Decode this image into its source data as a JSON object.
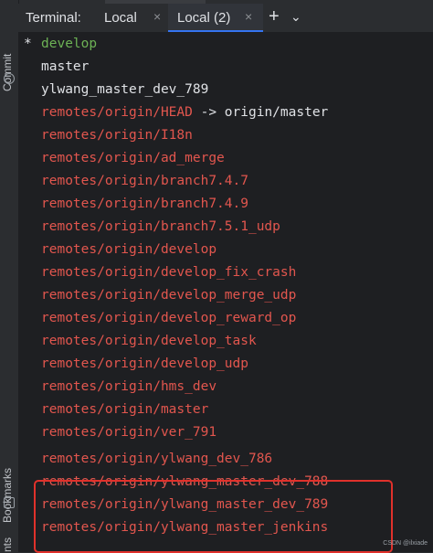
{
  "sidebar": {
    "commit_label": "Commit",
    "bookmarks_label": "Bookmarks",
    "extra_label": "nts"
  },
  "tabbar": {
    "title": "Terminal:",
    "tabs": [
      {
        "label": "Local",
        "close": "×"
      },
      {
        "label": "Local (2)",
        "close": "×",
        "active": true
      }
    ],
    "new_tab": "+",
    "dropdown": "⌄"
  },
  "terminal": {
    "current_marker": "*",
    "lines": [
      {
        "text": "develop",
        "color": "#6db255"
      },
      {
        "text": "master",
        "color": "#dfe1e5"
      },
      {
        "text": "ylwang_master_dev_789",
        "color": "#dfe1e5"
      },
      {
        "text": "remotes/origin/HEAD",
        "arrow": " -> origin/master",
        "color": "#e2564e"
      },
      {
        "text": "remotes/origin/I18n",
        "color": "#e2564e"
      },
      {
        "text": "remotes/origin/ad_merge",
        "color": "#e2564e"
      },
      {
        "text": "remotes/origin/branch7.4.7",
        "color": "#e2564e"
      },
      {
        "text": "remotes/origin/branch7.4.9",
        "color": "#e2564e"
      },
      {
        "text": "remotes/origin/branch7.5.1_udp",
        "color": "#e2564e"
      },
      {
        "text": "remotes/origin/develop",
        "color": "#e2564e"
      },
      {
        "text": "remotes/origin/develop_fix_crash",
        "color": "#e2564e"
      },
      {
        "text": "remotes/origin/develop_merge_udp",
        "color": "#e2564e"
      },
      {
        "text": "remotes/origin/develop_reward_op",
        "color": "#e2564e"
      },
      {
        "text": "remotes/origin/develop_task",
        "color": "#e2564e"
      },
      {
        "text": "remotes/origin/develop_udp",
        "color": "#e2564e"
      },
      {
        "text": "remotes/origin/hms_dev",
        "color": "#e2564e"
      },
      {
        "text": "remotes/origin/master",
        "color": "#e2564e"
      },
      {
        "text": "remotes/origin/ver_791",
        "color": "#e2564e"
      },
      {
        "text": "remotes/origin/ylwang_dev_786",
        "color": "#e2564e"
      },
      {
        "text": "remotes/origin/ylwang_master_dev_788",
        "color": "#e2564e"
      },
      {
        "text": "remotes/origin/ylwang_master_dev_789",
        "color": "#e2564e"
      },
      {
        "text": "remotes/origin/ylwang_master_jenkins",
        "color": "#e2564e"
      }
    ]
  },
  "watermark": "CSDN @ilxiade",
  "colors": {
    "highlight_box": "#e0312b",
    "active_tab_underline": "#3574f0",
    "terminal_bg": "#1e1f22"
  }
}
